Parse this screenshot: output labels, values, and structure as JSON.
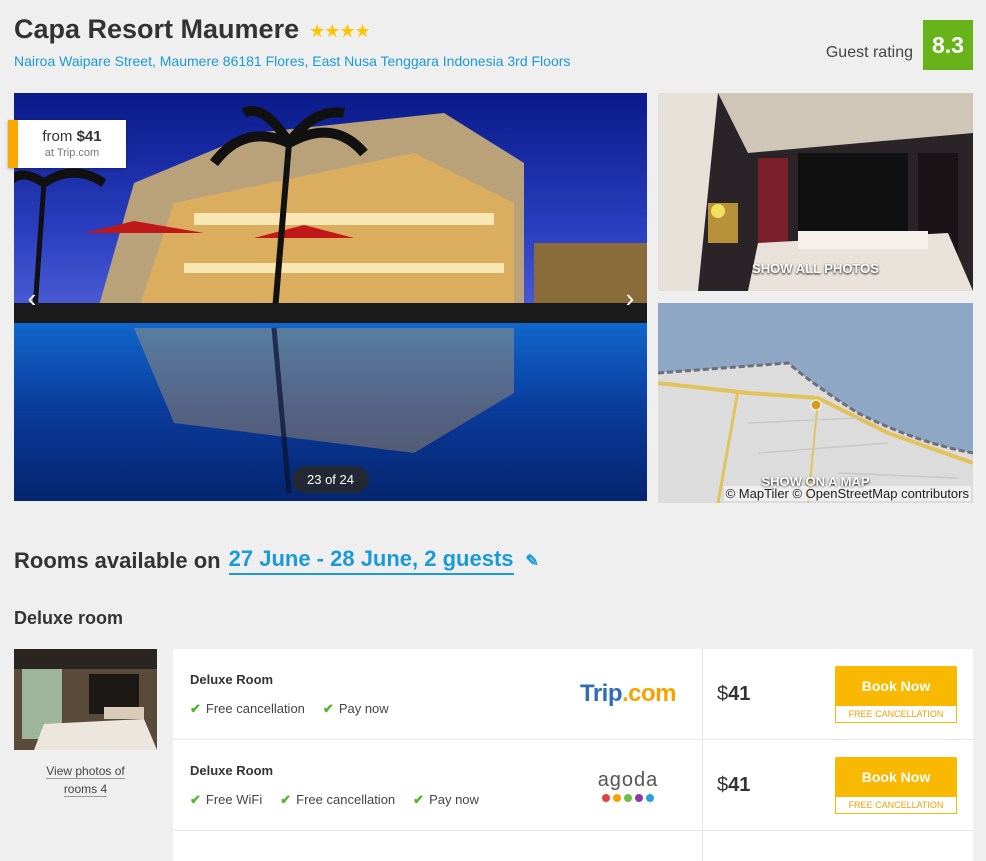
{
  "hotel": {
    "name": "Capa Resort Maumere",
    "stars": "★★★★",
    "address": "Nairoa Waipare Street, Maumere 86181 Flores, East Nusa Tenggara Indonesia 3rd Floors",
    "rating_label": "Guest rating",
    "rating_value": "8.3"
  },
  "gallery": {
    "from_prefix": "from",
    "from_price": "$41",
    "from_site": "at Trip.com",
    "counter": "23 of 24",
    "prev_icon": "chevron-left-icon",
    "next_icon": "chevron-right-icon",
    "show_all_photos": "SHOW ALL PHOTOS",
    "show_on_map": "SHOW ON A MAP",
    "map_attribution": "© MapTiler © OpenStreetMap contributors"
  },
  "rooms_section": {
    "heading_prefix": "Rooms available on",
    "dates": "27 June - 28 June, 2 guests",
    "edit_icon": "pencil-icon"
  },
  "room": {
    "type": "Deluxe room",
    "view_photos_line1": "View photos of",
    "view_photos_line2": "rooms 4",
    "offers": [
      {
        "name": "Deluxe Room",
        "features": [
          "Free cancellation",
          "Pay now"
        ],
        "vendor": "Trip.com",
        "vendor_main": "Trip",
        "vendor_suffix": ".com",
        "currency": "$",
        "price": "41",
        "button": "Book Now",
        "button_note": "FREE CANCELLATION"
      },
      {
        "name": "Deluxe Room",
        "features": [
          "Free WiFi",
          "Free cancellation",
          "Pay now"
        ],
        "vendor": "agoda",
        "currency": "$",
        "price": "41",
        "button": "Book Now",
        "button_note": "FREE CANCELLATION"
      }
    ]
  },
  "colors": {
    "accent_blue": "#1a9ad6",
    "rating_green": "#69b31a",
    "book_yellow": "#f9b900",
    "check_green": "#55b52a",
    "agoda_dots": [
      "#e8403e",
      "#f5a300",
      "#6cbf44",
      "#8a3ba3",
      "#22a3dd"
    ]
  }
}
